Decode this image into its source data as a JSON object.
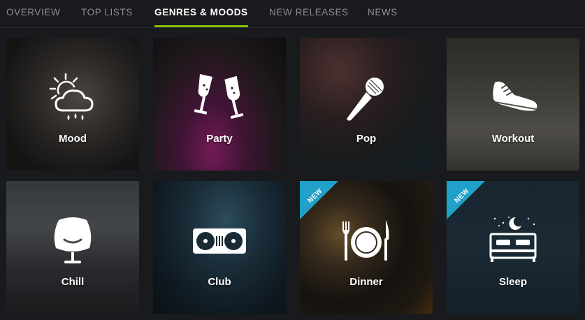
{
  "nav": {
    "tabs": [
      {
        "label": "OVERVIEW",
        "active": false
      },
      {
        "label": "TOP LISTS",
        "active": false
      },
      {
        "label": "GENRES & MOODS",
        "active": true
      },
      {
        "label": "NEW RELEASES",
        "active": false
      },
      {
        "label": "NEWS",
        "active": false
      }
    ],
    "accent": "#84bd00"
  },
  "tiles": [
    {
      "label": "Mood",
      "icon": "sun-cloud-rain-icon",
      "is_new": false
    },
    {
      "label": "Party",
      "icon": "champagne-glasses-icon",
      "is_new": false
    },
    {
      "label": "Pop",
      "icon": "microphone-icon",
      "is_new": false
    },
    {
      "label": "Workout",
      "icon": "sneaker-icon",
      "is_new": false
    },
    {
      "label": "Chill",
      "icon": "egg-chair-icon",
      "is_new": false
    },
    {
      "label": "Club",
      "icon": "turntables-icon",
      "is_new": false
    },
    {
      "label": "Dinner",
      "icon": "plate-cutlery-icon",
      "is_new": true,
      "badge": "NEW"
    },
    {
      "label": "Sleep",
      "icon": "bed-moon-icon",
      "is_new": true,
      "badge": "NEW"
    }
  ],
  "colors": {
    "background": "#181a1d",
    "badge": "#21a0c9",
    "tab_inactive": "#8d8f93",
    "tab_active": "#ffffff"
  }
}
